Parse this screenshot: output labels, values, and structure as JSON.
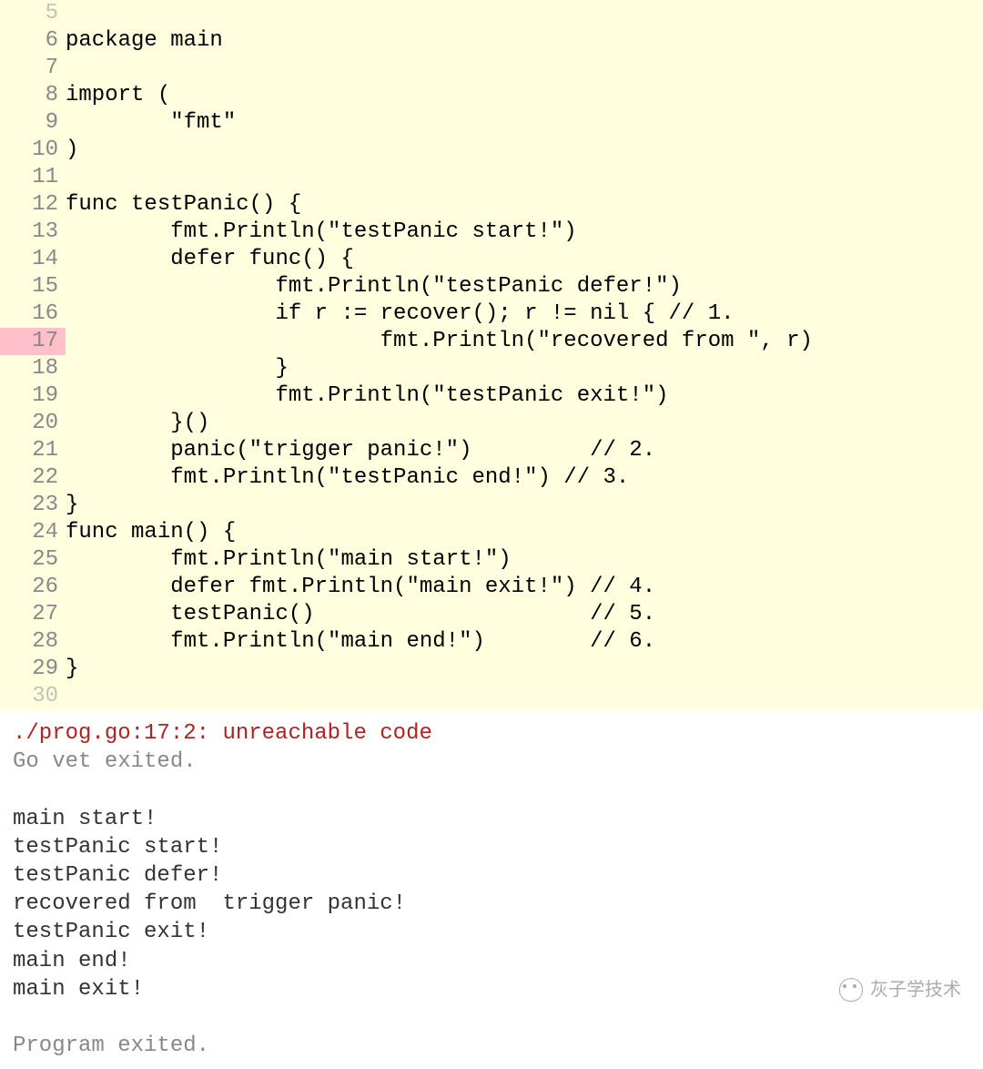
{
  "code": {
    "lines": [
      {
        "num": "5",
        "text": "",
        "highlight": false,
        "partial": true
      },
      {
        "num": "6",
        "text": "package main",
        "highlight": false
      },
      {
        "num": "7",
        "text": "",
        "highlight": false
      },
      {
        "num": "8",
        "text": "import (",
        "highlight": false
      },
      {
        "num": "9",
        "text": "        \"fmt\"",
        "highlight": false
      },
      {
        "num": "10",
        "text": ")",
        "highlight": false
      },
      {
        "num": "11",
        "text": "",
        "highlight": false
      },
      {
        "num": "12",
        "text": "func testPanic() {",
        "highlight": false
      },
      {
        "num": "13",
        "text": "        fmt.Println(\"testPanic start!\")",
        "highlight": false
      },
      {
        "num": "14",
        "text": "        defer func() {",
        "highlight": false
      },
      {
        "num": "15",
        "text": "                fmt.Println(\"testPanic defer!\")",
        "highlight": false
      },
      {
        "num": "16",
        "text": "                if r := recover(); r != nil { // 1.",
        "highlight": false
      },
      {
        "num": "17",
        "text": "                        fmt.Println(\"recovered from \", r)",
        "highlight": true
      },
      {
        "num": "18",
        "text": "                }",
        "highlight": false
      },
      {
        "num": "19",
        "text": "                fmt.Println(\"testPanic exit!\")",
        "highlight": false
      },
      {
        "num": "20",
        "text": "        }()",
        "highlight": false
      },
      {
        "num": "21",
        "text": "        panic(\"trigger panic!\")         // 2.",
        "highlight": false
      },
      {
        "num": "22",
        "text": "        fmt.Println(\"testPanic end!\") // 3.",
        "highlight": false
      },
      {
        "num": "23",
        "text": "}",
        "highlight": false
      },
      {
        "num": "24",
        "text": "func main() {",
        "highlight": false
      },
      {
        "num": "25",
        "text": "        fmt.Println(\"main start!\")",
        "highlight": false
      },
      {
        "num": "26",
        "text": "        defer fmt.Println(\"main exit!\") // 4.",
        "highlight": false
      },
      {
        "num": "27",
        "text": "        testPanic()                     // 5.",
        "highlight": false
      },
      {
        "num": "28",
        "text": "        fmt.Println(\"main end!\")        // 6.",
        "highlight": false
      },
      {
        "num": "29",
        "text": "}",
        "highlight": false
      },
      {
        "num": "30",
        "text": "",
        "highlight": false,
        "partial": true
      }
    ]
  },
  "output": {
    "lines": [
      {
        "text": "./prog.go:17:2: unreachable code",
        "class": "output-error"
      },
      {
        "text": "Go vet exited.",
        "class": "output-info"
      },
      {
        "text": "",
        "class": "output-normal"
      },
      {
        "text": "main start!",
        "class": "output-normal"
      },
      {
        "text": "testPanic start!",
        "class": "output-normal"
      },
      {
        "text": "testPanic defer!",
        "class": "output-normal"
      },
      {
        "text": "recovered from  trigger panic!",
        "class": "output-normal"
      },
      {
        "text": "testPanic exit!",
        "class": "output-normal"
      },
      {
        "text": "main end!",
        "class": "output-normal"
      },
      {
        "text": "main exit!",
        "class": "output-normal"
      },
      {
        "text": "",
        "class": "output-normal"
      },
      {
        "text": "Program exited.",
        "class": "output-info"
      }
    ]
  },
  "watermark": {
    "text": "灰子学技术"
  }
}
